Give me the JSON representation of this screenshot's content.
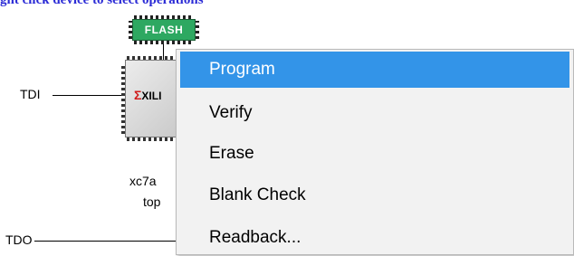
{
  "hint_text": "ght click device to select operations",
  "chain": {
    "tdi_label": "TDI",
    "tdo_label": "TDO",
    "flash": {
      "label": "FLASH"
    },
    "fpga": {
      "logo_text": "XILI",
      "device_name": "xc7a",
      "file_name": "top"
    }
  },
  "context_menu": {
    "items": [
      {
        "label": "Program",
        "highlighted": true
      },
      {
        "label": "Verify",
        "highlighted": false
      },
      {
        "label": "Erase",
        "highlighted": false
      },
      {
        "label": "Blank Check",
        "highlighted": false
      },
      {
        "label": "Readback...",
        "highlighted": false
      }
    ]
  },
  "colors": {
    "highlight": "#3394e8",
    "flash_chip": "#2ea861",
    "hint_text": "#2b2bd6"
  }
}
